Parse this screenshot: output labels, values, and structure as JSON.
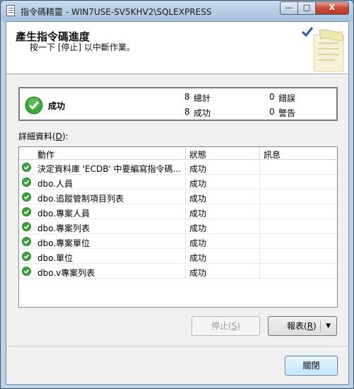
{
  "window": {
    "title": "指令碼精靈 - WIN7USE-SV5KHV2\\SQLEXPRESS",
    "minimize_label": "—",
    "maximize_label": "□",
    "close_label": "X"
  },
  "header": {
    "title": "產生指令碼進度",
    "subtitle": "按一下 [停止] 以中斷作業。"
  },
  "status": {
    "text": "成功",
    "total_count": "8",
    "total_label": "總計",
    "success_count": "8",
    "success_label": "成功",
    "error_count": "0",
    "error_label": "錯誤",
    "warning_count": "0",
    "warning_label": "警告"
  },
  "details": {
    "label_prefix": "詳細資料(",
    "label_key": "D",
    "label_suffix": "):",
    "columns": {
      "action": "動作",
      "status": "狀態",
      "message": "訊息"
    },
    "rows": [
      {
        "action": "決定資料庫 'ECDB' 中要編寫指令碼...",
        "status": "成功",
        "message": ""
      },
      {
        "action": "dbo.人員",
        "status": "成功",
        "message": ""
      },
      {
        "action": "dbo.追蹤管制項目列表",
        "status": "成功",
        "message": ""
      },
      {
        "action": "dbo.專案人員",
        "status": "成功",
        "message": ""
      },
      {
        "action": "dbo.專案列表",
        "status": "成功",
        "message": ""
      },
      {
        "action": "dbo.專案單位",
        "status": "成功",
        "message": ""
      },
      {
        "action": "dbo.單位",
        "status": "成功",
        "message": ""
      },
      {
        "action": "dbo.v專案列表",
        "status": "成功",
        "message": ""
      }
    ]
  },
  "buttons": {
    "stop_prefix": "停止(",
    "stop_key": "S",
    "stop_suffix": ")",
    "report_prefix": "報表(",
    "report_key": "R",
    "report_suffix": ")",
    "report_arrow": "▼",
    "close": "關閉"
  },
  "colors": {
    "success_green": "#3aa53a",
    "titlebar": "#a6c1dc",
    "close_red": "#c74a36"
  },
  "icons": {
    "status": "check-circle-icon",
    "row": "check-circle-icon",
    "header_art": "document-checkmark-icon"
  }
}
